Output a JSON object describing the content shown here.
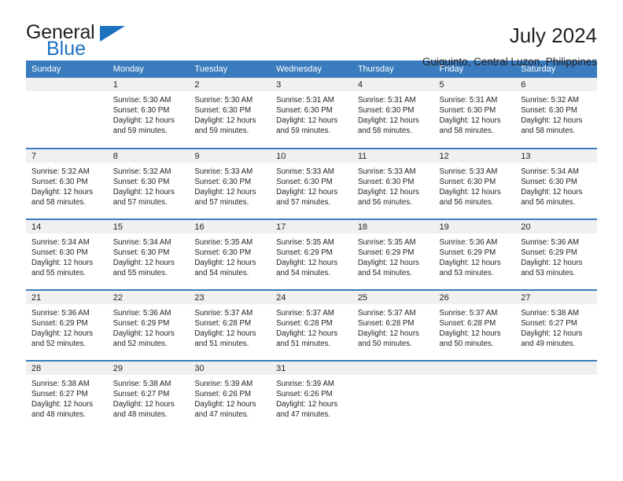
{
  "logo": {
    "word1": "General",
    "word2": "Blue",
    "triangle_color": "#1c72c0"
  },
  "header": {
    "title": "July 2024",
    "subtitle": "Guiguinto, Central Luzon, Philippines"
  },
  "theme": {
    "header_bg": "#3a7cbe",
    "daynum_bg": "#f0f0f0",
    "text": "#231f20"
  },
  "weekday_headers": [
    "Sunday",
    "Monday",
    "Tuesday",
    "Wednesday",
    "Thursday",
    "Friday",
    "Saturday"
  ],
  "weeks": [
    [
      {
        "day": "",
        "sunrise": "",
        "sunset": "",
        "daylight_1": "",
        "daylight_2": ""
      },
      {
        "day": "1",
        "sunrise": "Sunrise: 5:30 AM",
        "sunset": "Sunset: 6:30 PM",
        "daylight_1": "Daylight: 12 hours",
        "daylight_2": "and 59 minutes."
      },
      {
        "day": "2",
        "sunrise": "Sunrise: 5:30 AM",
        "sunset": "Sunset: 6:30 PM",
        "daylight_1": "Daylight: 12 hours",
        "daylight_2": "and 59 minutes."
      },
      {
        "day": "3",
        "sunrise": "Sunrise: 5:31 AM",
        "sunset": "Sunset: 6:30 PM",
        "daylight_1": "Daylight: 12 hours",
        "daylight_2": "and 59 minutes."
      },
      {
        "day": "4",
        "sunrise": "Sunrise: 5:31 AM",
        "sunset": "Sunset: 6:30 PM",
        "daylight_1": "Daylight: 12 hours",
        "daylight_2": "and 58 minutes."
      },
      {
        "day": "5",
        "sunrise": "Sunrise: 5:31 AM",
        "sunset": "Sunset: 6:30 PM",
        "daylight_1": "Daylight: 12 hours",
        "daylight_2": "and 58 minutes."
      },
      {
        "day": "6",
        "sunrise": "Sunrise: 5:32 AM",
        "sunset": "Sunset: 6:30 PM",
        "daylight_1": "Daylight: 12 hours",
        "daylight_2": "and 58 minutes."
      }
    ],
    [
      {
        "day": "7",
        "sunrise": "Sunrise: 5:32 AM",
        "sunset": "Sunset: 6:30 PM",
        "daylight_1": "Daylight: 12 hours",
        "daylight_2": "and 58 minutes."
      },
      {
        "day": "8",
        "sunrise": "Sunrise: 5:32 AM",
        "sunset": "Sunset: 6:30 PM",
        "daylight_1": "Daylight: 12 hours",
        "daylight_2": "and 57 minutes."
      },
      {
        "day": "9",
        "sunrise": "Sunrise: 5:33 AM",
        "sunset": "Sunset: 6:30 PM",
        "daylight_1": "Daylight: 12 hours",
        "daylight_2": "and 57 minutes."
      },
      {
        "day": "10",
        "sunrise": "Sunrise: 5:33 AM",
        "sunset": "Sunset: 6:30 PM",
        "daylight_1": "Daylight: 12 hours",
        "daylight_2": "and 57 minutes."
      },
      {
        "day": "11",
        "sunrise": "Sunrise: 5:33 AM",
        "sunset": "Sunset: 6:30 PM",
        "daylight_1": "Daylight: 12 hours",
        "daylight_2": "and 56 minutes."
      },
      {
        "day": "12",
        "sunrise": "Sunrise: 5:33 AM",
        "sunset": "Sunset: 6:30 PM",
        "daylight_1": "Daylight: 12 hours",
        "daylight_2": "and 56 minutes."
      },
      {
        "day": "13",
        "sunrise": "Sunrise: 5:34 AM",
        "sunset": "Sunset: 6:30 PM",
        "daylight_1": "Daylight: 12 hours",
        "daylight_2": "and 56 minutes."
      }
    ],
    [
      {
        "day": "14",
        "sunrise": "Sunrise: 5:34 AM",
        "sunset": "Sunset: 6:30 PM",
        "daylight_1": "Daylight: 12 hours",
        "daylight_2": "and 55 minutes."
      },
      {
        "day": "15",
        "sunrise": "Sunrise: 5:34 AM",
        "sunset": "Sunset: 6:30 PM",
        "daylight_1": "Daylight: 12 hours",
        "daylight_2": "and 55 minutes."
      },
      {
        "day": "16",
        "sunrise": "Sunrise: 5:35 AM",
        "sunset": "Sunset: 6:30 PM",
        "daylight_1": "Daylight: 12 hours",
        "daylight_2": "and 54 minutes."
      },
      {
        "day": "17",
        "sunrise": "Sunrise: 5:35 AM",
        "sunset": "Sunset: 6:29 PM",
        "daylight_1": "Daylight: 12 hours",
        "daylight_2": "and 54 minutes."
      },
      {
        "day": "18",
        "sunrise": "Sunrise: 5:35 AM",
        "sunset": "Sunset: 6:29 PM",
        "daylight_1": "Daylight: 12 hours",
        "daylight_2": "and 54 minutes."
      },
      {
        "day": "19",
        "sunrise": "Sunrise: 5:36 AM",
        "sunset": "Sunset: 6:29 PM",
        "daylight_1": "Daylight: 12 hours",
        "daylight_2": "and 53 minutes."
      },
      {
        "day": "20",
        "sunrise": "Sunrise: 5:36 AM",
        "sunset": "Sunset: 6:29 PM",
        "daylight_1": "Daylight: 12 hours",
        "daylight_2": "and 53 minutes."
      }
    ],
    [
      {
        "day": "21",
        "sunrise": "Sunrise: 5:36 AM",
        "sunset": "Sunset: 6:29 PM",
        "daylight_1": "Daylight: 12 hours",
        "daylight_2": "and 52 minutes."
      },
      {
        "day": "22",
        "sunrise": "Sunrise: 5:36 AM",
        "sunset": "Sunset: 6:29 PM",
        "daylight_1": "Daylight: 12 hours",
        "daylight_2": "and 52 minutes."
      },
      {
        "day": "23",
        "sunrise": "Sunrise: 5:37 AM",
        "sunset": "Sunset: 6:28 PM",
        "daylight_1": "Daylight: 12 hours",
        "daylight_2": "and 51 minutes."
      },
      {
        "day": "24",
        "sunrise": "Sunrise: 5:37 AM",
        "sunset": "Sunset: 6:28 PM",
        "daylight_1": "Daylight: 12 hours",
        "daylight_2": "and 51 minutes."
      },
      {
        "day": "25",
        "sunrise": "Sunrise: 5:37 AM",
        "sunset": "Sunset: 6:28 PM",
        "daylight_1": "Daylight: 12 hours",
        "daylight_2": "and 50 minutes."
      },
      {
        "day": "26",
        "sunrise": "Sunrise: 5:37 AM",
        "sunset": "Sunset: 6:28 PM",
        "daylight_1": "Daylight: 12 hours",
        "daylight_2": "and 50 minutes."
      },
      {
        "day": "27",
        "sunrise": "Sunrise: 5:38 AM",
        "sunset": "Sunset: 6:27 PM",
        "daylight_1": "Daylight: 12 hours",
        "daylight_2": "and 49 minutes."
      }
    ],
    [
      {
        "day": "28",
        "sunrise": "Sunrise: 5:38 AM",
        "sunset": "Sunset: 6:27 PM",
        "daylight_1": "Daylight: 12 hours",
        "daylight_2": "and 48 minutes."
      },
      {
        "day": "29",
        "sunrise": "Sunrise: 5:38 AM",
        "sunset": "Sunset: 6:27 PM",
        "daylight_1": "Daylight: 12 hours",
        "daylight_2": "and 48 minutes."
      },
      {
        "day": "30",
        "sunrise": "Sunrise: 5:39 AM",
        "sunset": "Sunset: 6:26 PM",
        "daylight_1": "Daylight: 12 hours",
        "daylight_2": "and 47 minutes."
      },
      {
        "day": "31",
        "sunrise": "Sunrise: 5:39 AM",
        "sunset": "Sunset: 6:26 PM",
        "daylight_1": "Daylight: 12 hours",
        "daylight_2": "and 47 minutes."
      },
      {
        "day": "",
        "sunrise": "",
        "sunset": "",
        "daylight_1": "",
        "daylight_2": ""
      },
      {
        "day": "",
        "sunrise": "",
        "sunset": "",
        "daylight_1": "",
        "daylight_2": ""
      },
      {
        "day": "",
        "sunrise": "",
        "sunset": "",
        "daylight_1": "",
        "daylight_2": ""
      }
    ]
  ]
}
